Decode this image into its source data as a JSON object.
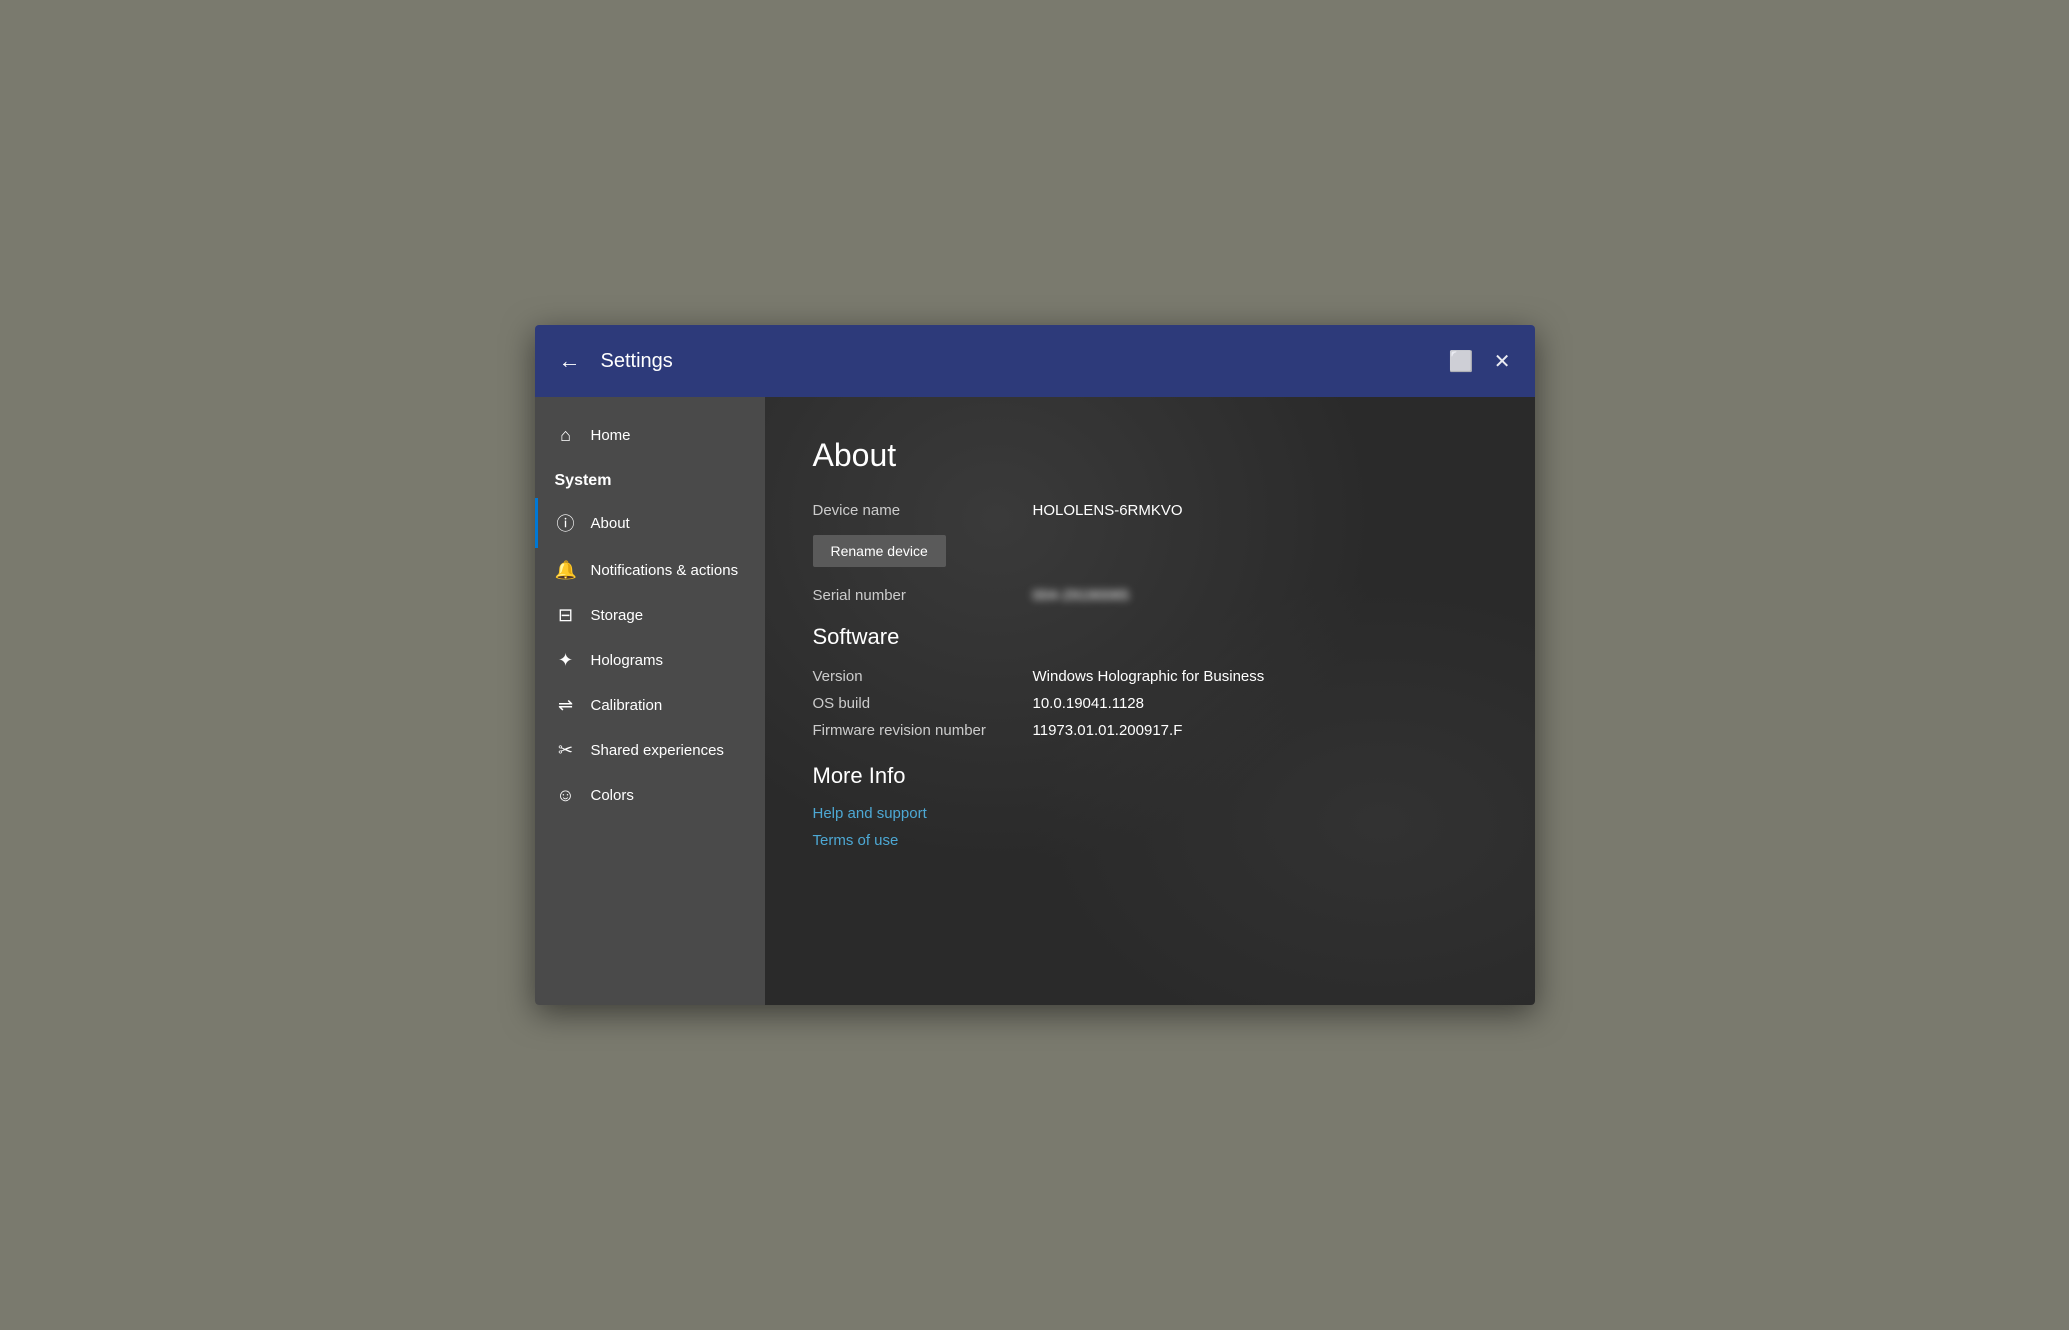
{
  "titleBar": {
    "title": "Settings",
    "backLabel": "←",
    "windowIcon": "⬜",
    "closeIcon": "✕"
  },
  "sidebar": {
    "homeLabel": "Home",
    "sectionLabel": "System",
    "items": [
      {
        "id": "about",
        "label": "About",
        "icon": "ⓘ",
        "active": true
      },
      {
        "id": "notifications",
        "label": "Notifications & actions",
        "icon": "⬜"
      },
      {
        "id": "storage",
        "label": "Storage",
        "icon": "⊟"
      },
      {
        "id": "holograms",
        "label": "Holograms",
        "icon": "✦"
      },
      {
        "id": "calibration",
        "label": "Calibration",
        "icon": "⇌"
      },
      {
        "id": "shared",
        "label": "Shared experiences",
        "icon": "✂"
      },
      {
        "id": "colors",
        "label": "Colors",
        "icon": "☺"
      }
    ]
  },
  "content": {
    "pageTitle": "About",
    "deviceNameLabel": "Device name",
    "deviceNameValue": "HOLOLENS-6RMKVO",
    "renameButtonLabel": "Rename device",
    "serialNumberLabel": "Serial number",
    "serialNumberValue": "004-29190065",
    "softwareHeading": "Software",
    "versionLabel": "Version",
    "versionValue": "Windows Holographic for Business",
    "osBuildLabel": "OS build",
    "osBuildValue": "10.0.19041.1128",
    "firmwareLabel": "Firmware revision number",
    "firmwareValue": "11973.01.01.200917.F",
    "moreInfoHeading": "More Info",
    "links": [
      {
        "id": "help",
        "label": "Help and support"
      },
      {
        "id": "terms",
        "label": "Terms of use"
      }
    ]
  }
}
